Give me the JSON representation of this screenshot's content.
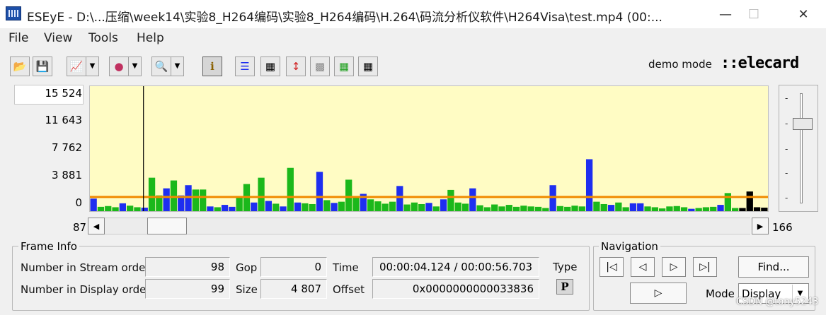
{
  "window": {
    "title": "ESEyE - D:\\...压缩\\week14\\实验8_H264编码\\实验8_H264编码\\H.264\\码流分析仪软件\\H264Visa\\test.mp4 (00:...",
    "min_glyph": "—",
    "max_glyph": "☐",
    "close_glyph": "✕"
  },
  "menu": [
    "File",
    "View",
    "Tools",
    "Help"
  ],
  "toolbar": {
    "buttons": [
      {
        "icon": "open-folder-icon",
        "glyph": "📂"
      },
      {
        "icon": "save-icon",
        "glyph": "💾"
      },
      {
        "icon": "chart-type-icon",
        "glyph": "📈"
      },
      {
        "icon": "color-wheel-icon",
        "glyph": "●"
      },
      {
        "icon": "zoom-icon",
        "glyph": "🔍"
      },
      {
        "icon": "info-icon",
        "glyph": "ℹ"
      },
      {
        "icon": "horizontal-lines-icon",
        "glyph": "☰"
      },
      {
        "icon": "grid-column-icon",
        "glyph": "▦"
      },
      {
        "icon": "arrows-icon",
        "glyph": "↕"
      },
      {
        "icon": "gray-grid-icon",
        "glyph": "▩"
      },
      {
        "icon": "color-grid-icon",
        "glyph": "▦"
      },
      {
        "icon": "table-icon",
        "glyph": "▦"
      }
    ],
    "dropdown_glyph": "▼",
    "demo_mode": "demo mode",
    "logo": "::elecard"
  },
  "chart_data": {
    "type": "bar",
    "yticks": [
      "15 524",
      "11 643",
      "7 762",
      "3 881",
      "0"
    ],
    "ylim": [
      0,
      15524
    ],
    "threshold": 600,
    "threshold_color": "#f08a00",
    "cursor_index": 7,
    "colors": {
      "I": "#1e2ef0",
      "P": "#1bb81b",
      "background": "#fffcc4"
    },
    "frame_types": [
      "I",
      "P",
      "P",
      "P",
      "I",
      "P",
      "P",
      "I",
      "P",
      "P",
      "I",
      "P",
      "I",
      "I",
      "P",
      "P",
      "I",
      "P",
      "I",
      "I",
      "P",
      "P",
      "I",
      "P",
      "I",
      "P",
      "I",
      "P",
      "I",
      "P",
      "P",
      "I",
      "P",
      "I",
      "P",
      "P",
      "P",
      "I",
      "P",
      "P",
      "P",
      "P",
      "I",
      "P",
      "P",
      "P",
      "I",
      "P",
      "I",
      "P",
      "P",
      "P",
      "I",
      "P",
      "P",
      "P",
      "P",
      "P",
      "P",
      "P",
      "P",
      "P",
      "P",
      "I",
      "P",
      "P",
      "P",
      "P",
      "I",
      "P",
      "P",
      "I",
      "P",
      "P",
      "I",
      "I",
      "P",
      "P",
      "P",
      "P",
      "P",
      "P",
      "I",
      "P",
      "P",
      "P",
      "I",
      "P",
      "P"
    ],
    "values": [
      1.6,
      0.55,
      0.65,
      0.5,
      1.0,
      0.7,
      0.5,
      0.45,
      4.25,
      2.0,
      2.9,
      3.9,
      2.0,
      3.3,
      2.75,
      2.75,
      0.6,
      0.5,
      0.8,
      0.55,
      1.8,
      3.45,
      1.1,
      4.25,
      1.3,
      0.95,
      0.6,
      5.5,
      1.1,
      1.0,
      0.9,
      5.0,
      1.4,
      1.05,
      1.2,
      4.0,
      1.8,
      2.2,
      1.5,
      1.25,
      0.95,
      1.2,
      3.2,
      0.85,
      1.1,
      0.9,
      1.05,
      0.6,
      1.5,
      2.7,
      1.1,
      0.95,
      2.9,
      0.75,
      0.5,
      0.85,
      0.6,
      0.8,
      0.55,
      0.7,
      0.6,
      0.55,
      0.4,
      3.3,
      0.65,
      0.55,
      0.7,
      0.6,
      6.6,
      1.2,
      0.9,
      0.8,
      1.1,
      0.5,
      1.0,
      1.0,
      0.6,
      0.5,
      0.35,
      0.6,
      0.65,
      0.5,
      0.3,
      0.4,
      0.5,
      0.55,
      0.8,
      2.3,
      0.4,
      0.4,
      2.5,
      0.5,
      0.45
    ]
  },
  "scroll": {
    "min": "87",
    "max": "166",
    "left_glyph": "◀",
    "right_glyph": "▶"
  },
  "slider_ticks": [
    "-",
    "-",
    "-",
    "-",
    "-"
  ],
  "frame_info": {
    "title": "Frame Info",
    "stream_order_label": "Number in Stream order",
    "stream_order_value": "98",
    "display_order_label": "Number in Display order",
    "display_order_value": "99",
    "gop_label": "Gop",
    "gop_value": "0",
    "size_label": "Size",
    "size_value": "4 807",
    "time_label": "Time",
    "time_value": "00:00:04.124 / 00:00:56.703",
    "offset_label": "Offset",
    "offset_value": "0x0000000000033836",
    "type_label": "Type",
    "type_value": "P"
  },
  "navigation": {
    "title": "Navigation",
    "first_glyph": "|◁",
    "prev_glyph": "◁",
    "next_glyph": "▷",
    "last_glyph": "▷|",
    "play_glyph": "▷",
    "find_label": "Find...",
    "mode_label": "Mode",
    "mode_value": "Display"
  },
  "watermark": "CSDN @tony5243"
}
